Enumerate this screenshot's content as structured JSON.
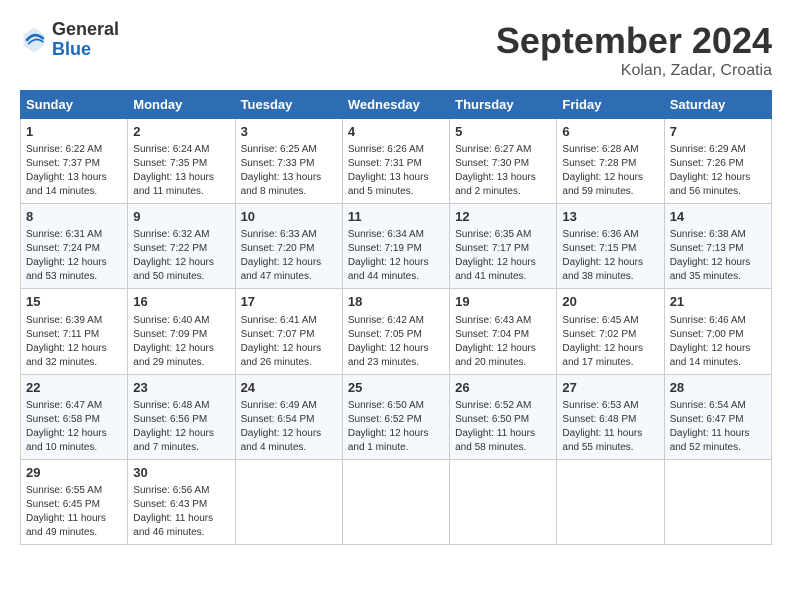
{
  "header": {
    "logo_general": "General",
    "logo_blue": "Blue",
    "month_title": "September 2024",
    "subtitle": "Kolan, Zadar, Croatia"
  },
  "days_of_week": [
    "Sunday",
    "Monday",
    "Tuesday",
    "Wednesday",
    "Thursday",
    "Friday",
    "Saturday"
  ],
  "weeks": [
    [
      {
        "day": "1",
        "sunrise": "Sunrise: 6:22 AM",
        "sunset": "Sunset: 7:37 PM",
        "daylight": "Daylight: 13 hours and 14 minutes."
      },
      {
        "day": "2",
        "sunrise": "Sunrise: 6:24 AM",
        "sunset": "Sunset: 7:35 PM",
        "daylight": "Daylight: 13 hours and 11 minutes."
      },
      {
        "day": "3",
        "sunrise": "Sunrise: 6:25 AM",
        "sunset": "Sunset: 7:33 PM",
        "daylight": "Daylight: 13 hours and 8 minutes."
      },
      {
        "day": "4",
        "sunrise": "Sunrise: 6:26 AM",
        "sunset": "Sunset: 7:31 PM",
        "daylight": "Daylight: 13 hours and 5 minutes."
      },
      {
        "day": "5",
        "sunrise": "Sunrise: 6:27 AM",
        "sunset": "Sunset: 7:30 PM",
        "daylight": "Daylight: 13 hours and 2 minutes."
      },
      {
        "day": "6",
        "sunrise": "Sunrise: 6:28 AM",
        "sunset": "Sunset: 7:28 PM",
        "daylight": "Daylight: 12 hours and 59 minutes."
      },
      {
        "day": "7",
        "sunrise": "Sunrise: 6:29 AM",
        "sunset": "Sunset: 7:26 PM",
        "daylight": "Daylight: 12 hours and 56 minutes."
      }
    ],
    [
      {
        "day": "8",
        "sunrise": "Sunrise: 6:31 AM",
        "sunset": "Sunset: 7:24 PM",
        "daylight": "Daylight: 12 hours and 53 minutes."
      },
      {
        "day": "9",
        "sunrise": "Sunrise: 6:32 AM",
        "sunset": "Sunset: 7:22 PM",
        "daylight": "Daylight: 12 hours and 50 minutes."
      },
      {
        "day": "10",
        "sunrise": "Sunrise: 6:33 AM",
        "sunset": "Sunset: 7:20 PM",
        "daylight": "Daylight: 12 hours and 47 minutes."
      },
      {
        "day": "11",
        "sunrise": "Sunrise: 6:34 AM",
        "sunset": "Sunset: 7:19 PM",
        "daylight": "Daylight: 12 hours and 44 minutes."
      },
      {
        "day": "12",
        "sunrise": "Sunrise: 6:35 AM",
        "sunset": "Sunset: 7:17 PM",
        "daylight": "Daylight: 12 hours and 41 minutes."
      },
      {
        "day": "13",
        "sunrise": "Sunrise: 6:36 AM",
        "sunset": "Sunset: 7:15 PM",
        "daylight": "Daylight: 12 hours and 38 minutes."
      },
      {
        "day": "14",
        "sunrise": "Sunrise: 6:38 AM",
        "sunset": "Sunset: 7:13 PM",
        "daylight": "Daylight: 12 hours and 35 minutes."
      }
    ],
    [
      {
        "day": "15",
        "sunrise": "Sunrise: 6:39 AM",
        "sunset": "Sunset: 7:11 PM",
        "daylight": "Daylight: 12 hours and 32 minutes."
      },
      {
        "day": "16",
        "sunrise": "Sunrise: 6:40 AM",
        "sunset": "Sunset: 7:09 PM",
        "daylight": "Daylight: 12 hours and 29 minutes."
      },
      {
        "day": "17",
        "sunrise": "Sunrise: 6:41 AM",
        "sunset": "Sunset: 7:07 PM",
        "daylight": "Daylight: 12 hours and 26 minutes."
      },
      {
        "day": "18",
        "sunrise": "Sunrise: 6:42 AM",
        "sunset": "Sunset: 7:05 PM",
        "daylight": "Daylight: 12 hours and 23 minutes."
      },
      {
        "day": "19",
        "sunrise": "Sunrise: 6:43 AM",
        "sunset": "Sunset: 7:04 PM",
        "daylight": "Daylight: 12 hours and 20 minutes."
      },
      {
        "day": "20",
        "sunrise": "Sunrise: 6:45 AM",
        "sunset": "Sunset: 7:02 PM",
        "daylight": "Daylight: 12 hours and 17 minutes."
      },
      {
        "day": "21",
        "sunrise": "Sunrise: 6:46 AM",
        "sunset": "Sunset: 7:00 PM",
        "daylight": "Daylight: 12 hours and 14 minutes."
      }
    ],
    [
      {
        "day": "22",
        "sunrise": "Sunrise: 6:47 AM",
        "sunset": "Sunset: 6:58 PM",
        "daylight": "Daylight: 12 hours and 10 minutes."
      },
      {
        "day": "23",
        "sunrise": "Sunrise: 6:48 AM",
        "sunset": "Sunset: 6:56 PM",
        "daylight": "Daylight: 12 hours and 7 minutes."
      },
      {
        "day": "24",
        "sunrise": "Sunrise: 6:49 AM",
        "sunset": "Sunset: 6:54 PM",
        "daylight": "Daylight: 12 hours and 4 minutes."
      },
      {
        "day": "25",
        "sunrise": "Sunrise: 6:50 AM",
        "sunset": "Sunset: 6:52 PM",
        "daylight": "Daylight: 12 hours and 1 minute."
      },
      {
        "day": "26",
        "sunrise": "Sunrise: 6:52 AM",
        "sunset": "Sunset: 6:50 PM",
        "daylight": "Daylight: 11 hours and 58 minutes."
      },
      {
        "day": "27",
        "sunrise": "Sunrise: 6:53 AM",
        "sunset": "Sunset: 6:48 PM",
        "daylight": "Daylight: 11 hours and 55 minutes."
      },
      {
        "day": "28",
        "sunrise": "Sunrise: 6:54 AM",
        "sunset": "Sunset: 6:47 PM",
        "daylight": "Daylight: 11 hours and 52 minutes."
      }
    ],
    [
      {
        "day": "29",
        "sunrise": "Sunrise: 6:55 AM",
        "sunset": "Sunset: 6:45 PM",
        "daylight": "Daylight: 11 hours and 49 minutes."
      },
      {
        "day": "30",
        "sunrise": "Sunrise: 6:56 AM",
        "sunset": "Sunset: 6:43 PM",
        "daylight": "Daylight: 11 hours and 46 minutes."
      },
      null,
      null,
      null,
      null,
      null
    ]
  ]
}
